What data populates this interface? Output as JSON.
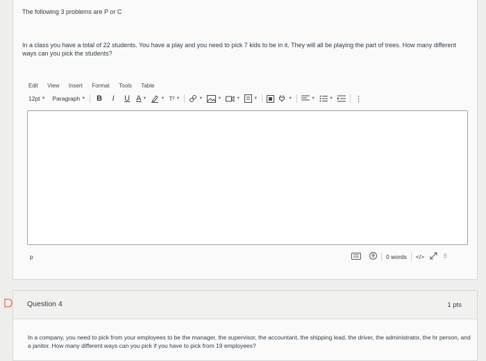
{
  "problems_intro": "The following 3 problems are P or C",
  "question3": {
    "text": "In a class you have a total of 22 students. You have a play and you need to pick 7 kids to be in it. They will all be playing the part of trees. How many different ways can you pick the students?"
  },
  "editor": {
    "menu": [
      "Edit",
      "View",
      "Insert",
      "Format",
      "Tools",
      "Table"
    ],
    "font_size": "12pt",
    "block_format": "Paragraph",
    "bold": "B",
    "italic": "I",
    "underline": "U",
    "text_color": "A",
    "superscript": "T²",
    "status_path": "p",
    "word_count": "0 words",
    "html_toggle": "</>"
  },
  "question4": {
    "marker": "D",
    "title": "Question 4",
    "points": "1 pts",
    "text": "In a company, you need to pick from your employees to be the manager, the supervisor, the accountant, the shipping lead, the driver, the administrator, the hr person, and a janitor. How many different ways can you pick if you have to pick from 19 employees?"
  },
  "colors": {
    "accent_marker": "#e8694a",
    "page_bg": "#eeeeec",
    "card_bg": "#fafafa",
    "text": "#2d3b45"
  }
}
